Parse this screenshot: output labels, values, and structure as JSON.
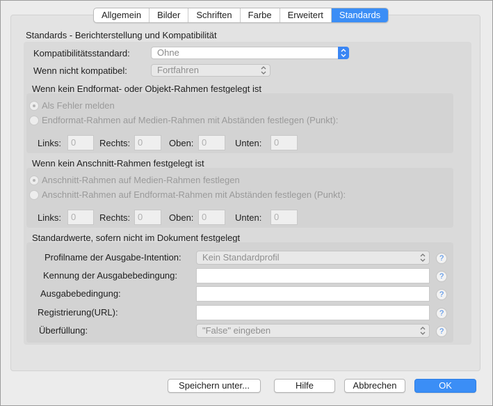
{
  "tabs": [
    {
      "label": "Allgemein"
    },
    {
      "label": "Bilder"
    },
    {
      "label": "Schriften"
    },
    {
      "label": "Farbe"
    },
    {
      "label": "Erweitert"
    },
    {
      "label": "Standards",
      "active": true
    }
  ],
  "section_title": "Standards - Berichterstellung und Kompatibilität",
  "compat": {
    "standard_label": "Kompatibilitätsstandard:",
    "standard_value": "Ohne",
    "noncompat_label": "Wenn nicht kompatibel:",
    "noncompat_value": "Fortfahren"
  },
  "trim": {
    "heading": "Wenn kein Endformat- oder Objekt-Rahmen festgelegt ist",
    "option1": "Als Fehler melden",
    "option2": "Endformat-Rahmen auf Medien-Rahmen mit Abständen festlegen (Punkt):",
    "left_label": "Links:",
    "left_value": "0",
    "right_label": "Rechts:",
    "right_value": "0",
    "top_label": "Oben:",
    "top_value": "0",
    "bottom_label": "Unten:",
    "bottom_value": "0"
  },
  "bleed": {
    "heading": "Wenn kein Anschnitt-Rahmen festgelegt ist",
    "option1": "Anschnitt-Rahmen auf Medien-Rahmen festlegen",
    "option2": "Anschnitt-Rahmen auf Endformat-Rahmen mit Abständen festlegen (Punkt):",
    "left_label": "Links:",
    "left_value": "0",
    "right_label": "Rechts:",
    "right_value": "0",
    "top_label": "Oben:",
    "top_value": "0",
    "bottom_label": "Unten:",
    "bottom_value": "0"
  },
  "defaults": {
    "heading": "Standardwerte, sofern nicht im Dokument festgelegt",
    "profile_label": "Profilname der Ausgabe-Intention:",
    "profile_value": "Kein Standardprofil",
    "condition_id_label": "Kennung der Ausgabebedingung:",
    "condition_id_value": "",
    "condition_label": "Ausgabebedingung:",
    "condition_value": "",
    "registry_label": "Registrierung(URL):",
    "registry_value": "",
    "trapped_label": "Überfüllung:",
    "trapped_value": "\"False\" eingeben",
    "help_glyph": "?"
  },
  "buttons": {
    "save_as": "Speichern unter...",
    "help": "Hilfe",
    "cancel": "Abbrechen",
    "ok": "OK"
  },
  "colors": {
    "accent": "#3b8ef6",
    "background": "#ececec"
  }
}
